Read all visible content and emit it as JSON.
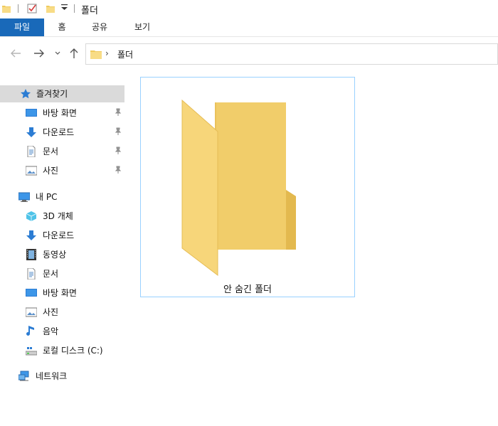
{
  "window": {
    "title": "폴더"
  },
  "ribbon": {
    "tabs": [
      "파일",
      "홈",
      "공유",
      "보기"
    ]
  },
  "address": {
    "path": "폴더"
  },
  "sidebar": {
    "quick_access": "즐겨찾기",
    "quick_items": [
      "바탕 화면",
      "다운로드",
      "문서",
      "사진"
    ],
    "this_pc": "내 PC",
    "pc_items": [
      "3D 개체",
      "다운로드",
      "동영상",
      "문서",
      "바탕 화면",
      "사진",
      "음악",
      "로컬 디스크 (C:)"
    ],
    "network": "네트워크"
  },
  "content": {
    "items": [
      {
        "name": "안 숨긴 폴더"
      }
    ]
  },
  "colors": {
    "accent": "#1969b9",
    "folder": "#f5d475",
    "selection_border": "#99d1ff"
  }
}
